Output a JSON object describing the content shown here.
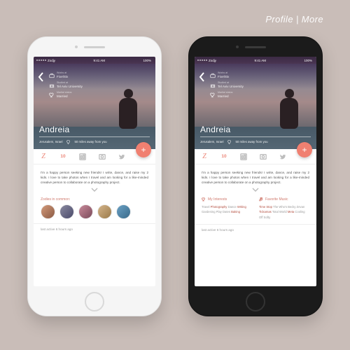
{
  "page_label": "Profile | More",
  "statusbar": {
    "carrier": "Zodjy",
    "time": "9:41 AM",
    "battery": "100%"
  },
  "hero": {
    "works_label": "Works at",
    "works_value": "FixelStx",
    "studied_label": "Studied at",
    "studied_value": "Tel Aviv University",
    "marital_label": "Marital status",
    "marital_value": "Married",
    "name": "Andreia",
    "location": "Jerusalem, Israel",
    "distance": "50 miles away from you"
  },
  "tabs": {
    "count": "10"
  },
  "bio": "I'm a happy person seeking new friends! I write, dance, and raise my 2 kids. I love to take photos when I travel and am looking for a like-minded creative person to collaborate on a photography project.",
  "left_screen": {
    "section_title": "Zodies in common:",
    "avatars": [
      {
        "bg": "linear-gradient(135deg,#d49a7a,#8a5a44)"
      },
      {
        "bg": "linear-gradient(135deg,#8a8aa0,#4a4a6a)"
      },
      {
        "bg": "linear-gradient(135deg,#c98a9a,#7a4a5a)"
      },
      {
        "bg": "linear-gradient(135deg,#d4b48a,#9a7a4a)"
      },
      {
        "bg": "linear-gradient(135deg,#6aa0c4,#3a6a8a)"
      }
    ]
  },
  "right_screen": {
    "interests_title": "My Interests",
    "interests_html": "Travel <span class='hi'>Photography</span> Dance <span class='hi'>Writing</span> Gardening Play Dates <span class='hi'>Baking</span>",
    "music_title": "Favorite Music",
    "music_html": "<span class='hi'>Time Stop</span> The Who's Becky Zevan <span class='hi'>Tickamas</span> Total World <span class='hi'>Meta</span> Cooling Off Softy"
  },
  "footer": "last active 6 hours ago"
}
